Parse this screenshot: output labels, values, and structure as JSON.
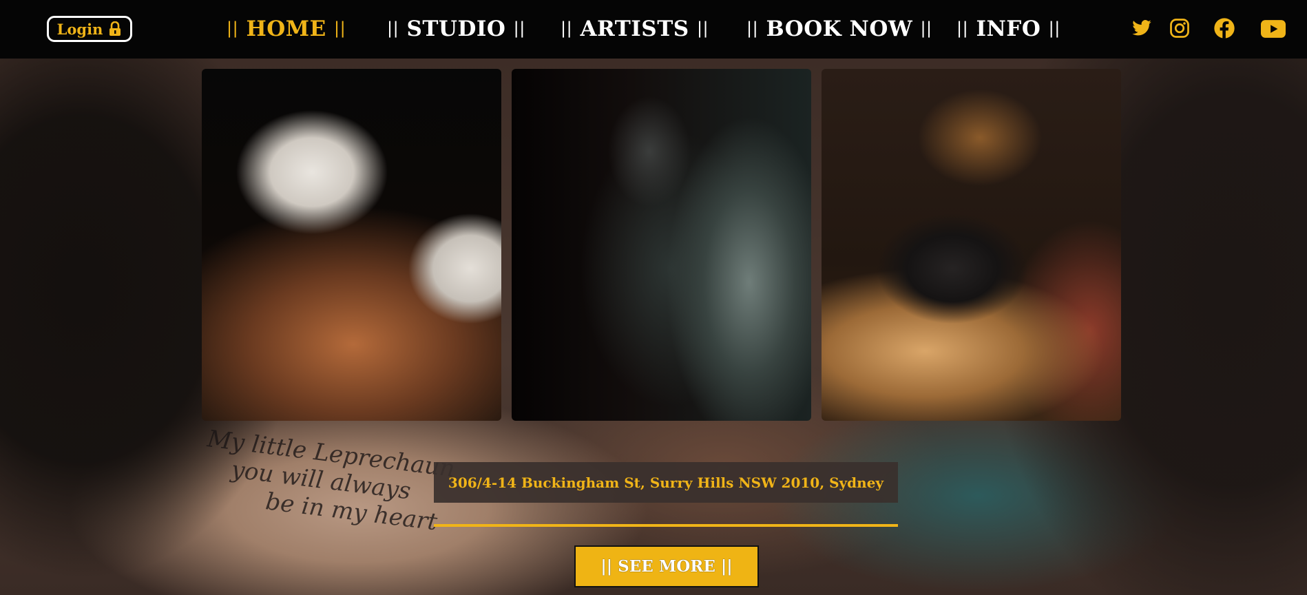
{
  "header": {
    "login_label": "Login",
    "lock_icon": "lock-icon",
    "nav": [
      {
        "label": "HOME",
        "active": true
      },
      {
        "label": "STUDIO",
        "active": false
      },
      {
        "label": "ARTISTS",
        "active": false
      },
      {
        "label": "BOOK NOW",
        "active": false
      },
      {
        "label": "INFO",
        "active": false
      }
    ],
    "nav_separator": "||",
    "social": [
      "twitter-icon",
      "instagram-icon",
      "facebook-icon",
      "youtube-icon"
    ]
  },
  "background": {
    "script_lines": [
      "My little Leprechaun",
      "you will always",
      "be in my heart"
    ]
  },
  "gallery": {
    "photos": [
      "tattoo-arm-sleeve-photo",
      "tattoo-artist-studio-photo",
      "tattoo-leg-work-photo"
    ]
  },
  "address": "306/4-14 Buckingham St, Surry Hills NSW 2010, Sydney",
  "cta": {
    "label": "|| SEE MORE ||"
  },
  "colors": {
    "accent": "#f0b418",
    "header_bg": "#050505",
    "text_light": "#ffffff"
  }
}
